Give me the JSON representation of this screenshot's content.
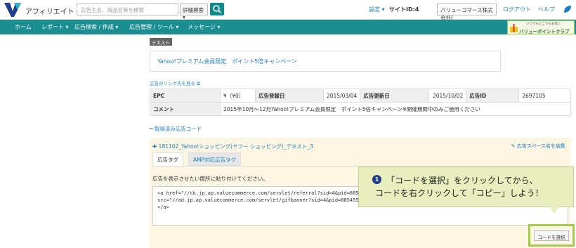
{
  "header": {
    "app_name": "アフィリエイト",
    "search_placeholder": "広告主名、商品名等を検索",
    "advanced_search_label": "詳細検索 ▾",
    "settings_label": "設定 ▾",
    "site_id_label": "サイトID:4",
    "site_select_value": "バリューコマース株式会社(",
    "logout_label": "ログアウト",
    "help_label": "ヘルプ"
  },
  "nav": {
    "items": [
      {
        "label": "ホーム"
      },
      {
        "label": "レポート ▾"
      },
      {
        "label": "広告検索 / 作成 ▾"
      },
      {
        "label": "広告管理 / ツール ▾"
      },
      {
        "label": "メッセージ ▾"
      }
    ],
    "banner_label": "バリューポイントクラブ",
    "banner_sub": "いつでもどこでもお得に"
  },
  "ad": {
    "type_tag": "テキスト",
    "text": "Yahoo!プレミアム会員限定　ポイント5倍キャンペーン",
    "link_dest_label": "広告のリンク先を見る",
    "table": {
      "epc_label": "EPC",
      "epc_value": "¥（¥0）",
      "registered_label": "広告登録日",
      "registered_value": "2015/03/04",
      "updated_label": "広告更新日",
      "updated_value": "2015/10/02",
      "id_label": "広告ID",
      "id_value": "2697105",
      "comment_label": "コメント",
      "comment_value": "2015年10月〜12月Yahoo!プレミアム会員限定　ポイント5倍キャンペーン※開催期間中のみご使用ください"
    },
    "fetched_label": "━ 取得済み広告コード"
  },
  "code_panel": {
    "title": "✚ 181102_Yahoo!ショッピング(ヤフー ショッピング)_テキスト_3",
    "edit_label": "✎ 広告スペース名を編集",
    "tabs": [
      {
        "label": "広告タグ"
      },
      {
        "label": "AMP対応広告タグ"
      }
    ],
    "instruction": "広告を表示させたい箇所に貼り付けてください。",
    "code_line1": "<a href=\"//ck.jp.ap.valuecommerce.com/servlet/referral?sid=4&pid=885455640\"",
    "code_line2": "src=\"//ad.jp.ap.valuecommerce.com/servlet/gifbanner?sid=4&pid=885455640\" h",
    "code_line3": "</a>",
    "select_code_label": "コードを選択"
  },
  "callout": {
    "step": "1",
    "line1": "「コードを選択」をクリックしてから、",
    "line2": "コードを右クリックして「コピー」しよう！"
  },
  "colors": {
    "nav_bg": "#1a8e90",
    "link": "#1a7ec5",
    "callout_bg": "#e8eebd",
    "highlight": "#a4c94d"
  }
}
